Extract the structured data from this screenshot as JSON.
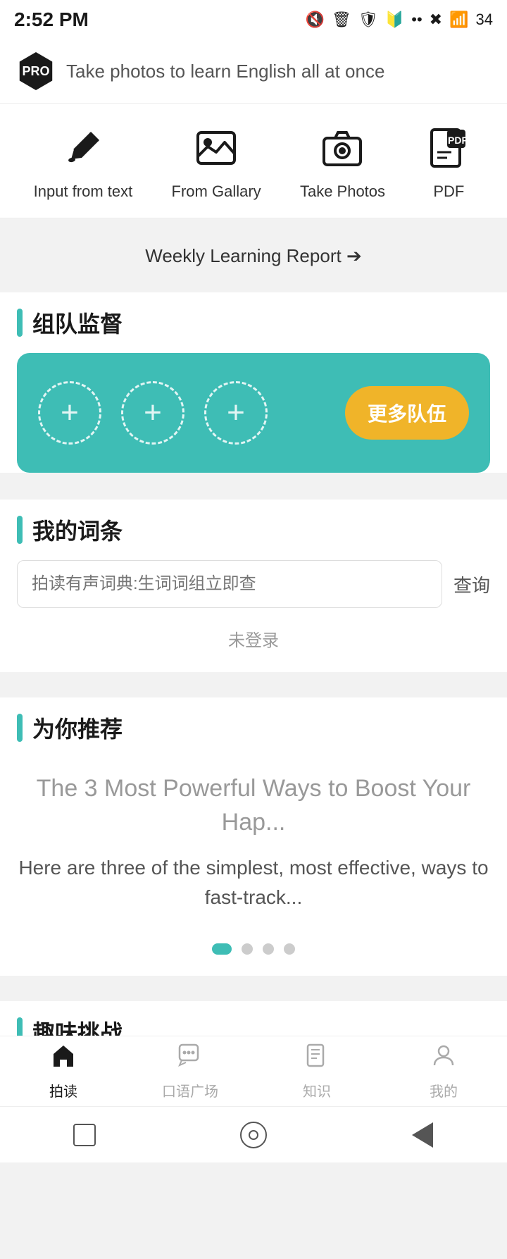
{
  "statusBar": {
    "time": "2:52 PM",
    "battery": "34"
  },
  "header": {
    "proBadge": "PRO",
    "tagline": "Take photos to learn English all at once"
  },
  "quickActions": [
    {
      "id": "input-text",
      "label": "Input from text",
      "icon": "pencil"
    },
    {
      "id": "from-gallery",
      "label": "From Gallary",
      "icon": "image"
    },
    {
      "id": "take-photos",
      "label": "Take Photos",
      "icon": "camera"
    },
    {
      "id": "pdf",
      "label": "PDF",
      "icon": "pdf"
    }
  ],
  "weeklyReport": {
    "label": "Weekly Learning Report",
    "arrow": "➔"
  },
  "teamSection": {
    "title": "组队监督",
    "moreTeamBtn": "更多队伍",
    "plusCircles": [
      "+",
      "+",
      "+"
    ]
  },
  "wordsSection": {
    "title": "我的词条",
    "searchPlaceholder": "拍读有声词典:生词词组立即查",
    "searchBtn": "查询",
    "notLoggedIn": "未登录"
  },
  "recommendSection": {
    "title": "为你推荐",
    "articleTitle": "The 3 Most Powerful Ways to Boost Your Hap...",
    "articleDesc": "Here are three of the simplest, most effective, ways to fast-track...",
    "dots": [
      {
        "active": true
      },
      {
        "active": false
      },
      {
        "active": false
      },
      {
        "active": false
      }
    ]
  },
  "challengeSection": {
    "title": "趣味挑战"
  },
  "bottomNav": [
    {
      "id": "home",
      "label": "拍读",
      "icon": "home",
      "active": true
    },
    {
      "id": "speech",
      "label": "口语广场",
      "icon": "chat",
      "active": false
    },
    {
      "id": "knowledge",
      "label": "知识",
      "icon": "book",
      "active": false
    },
    {
      "id": "mine",
      "label": "我的",
      "icon": "person",
      "active": false
    }
  ]
}
